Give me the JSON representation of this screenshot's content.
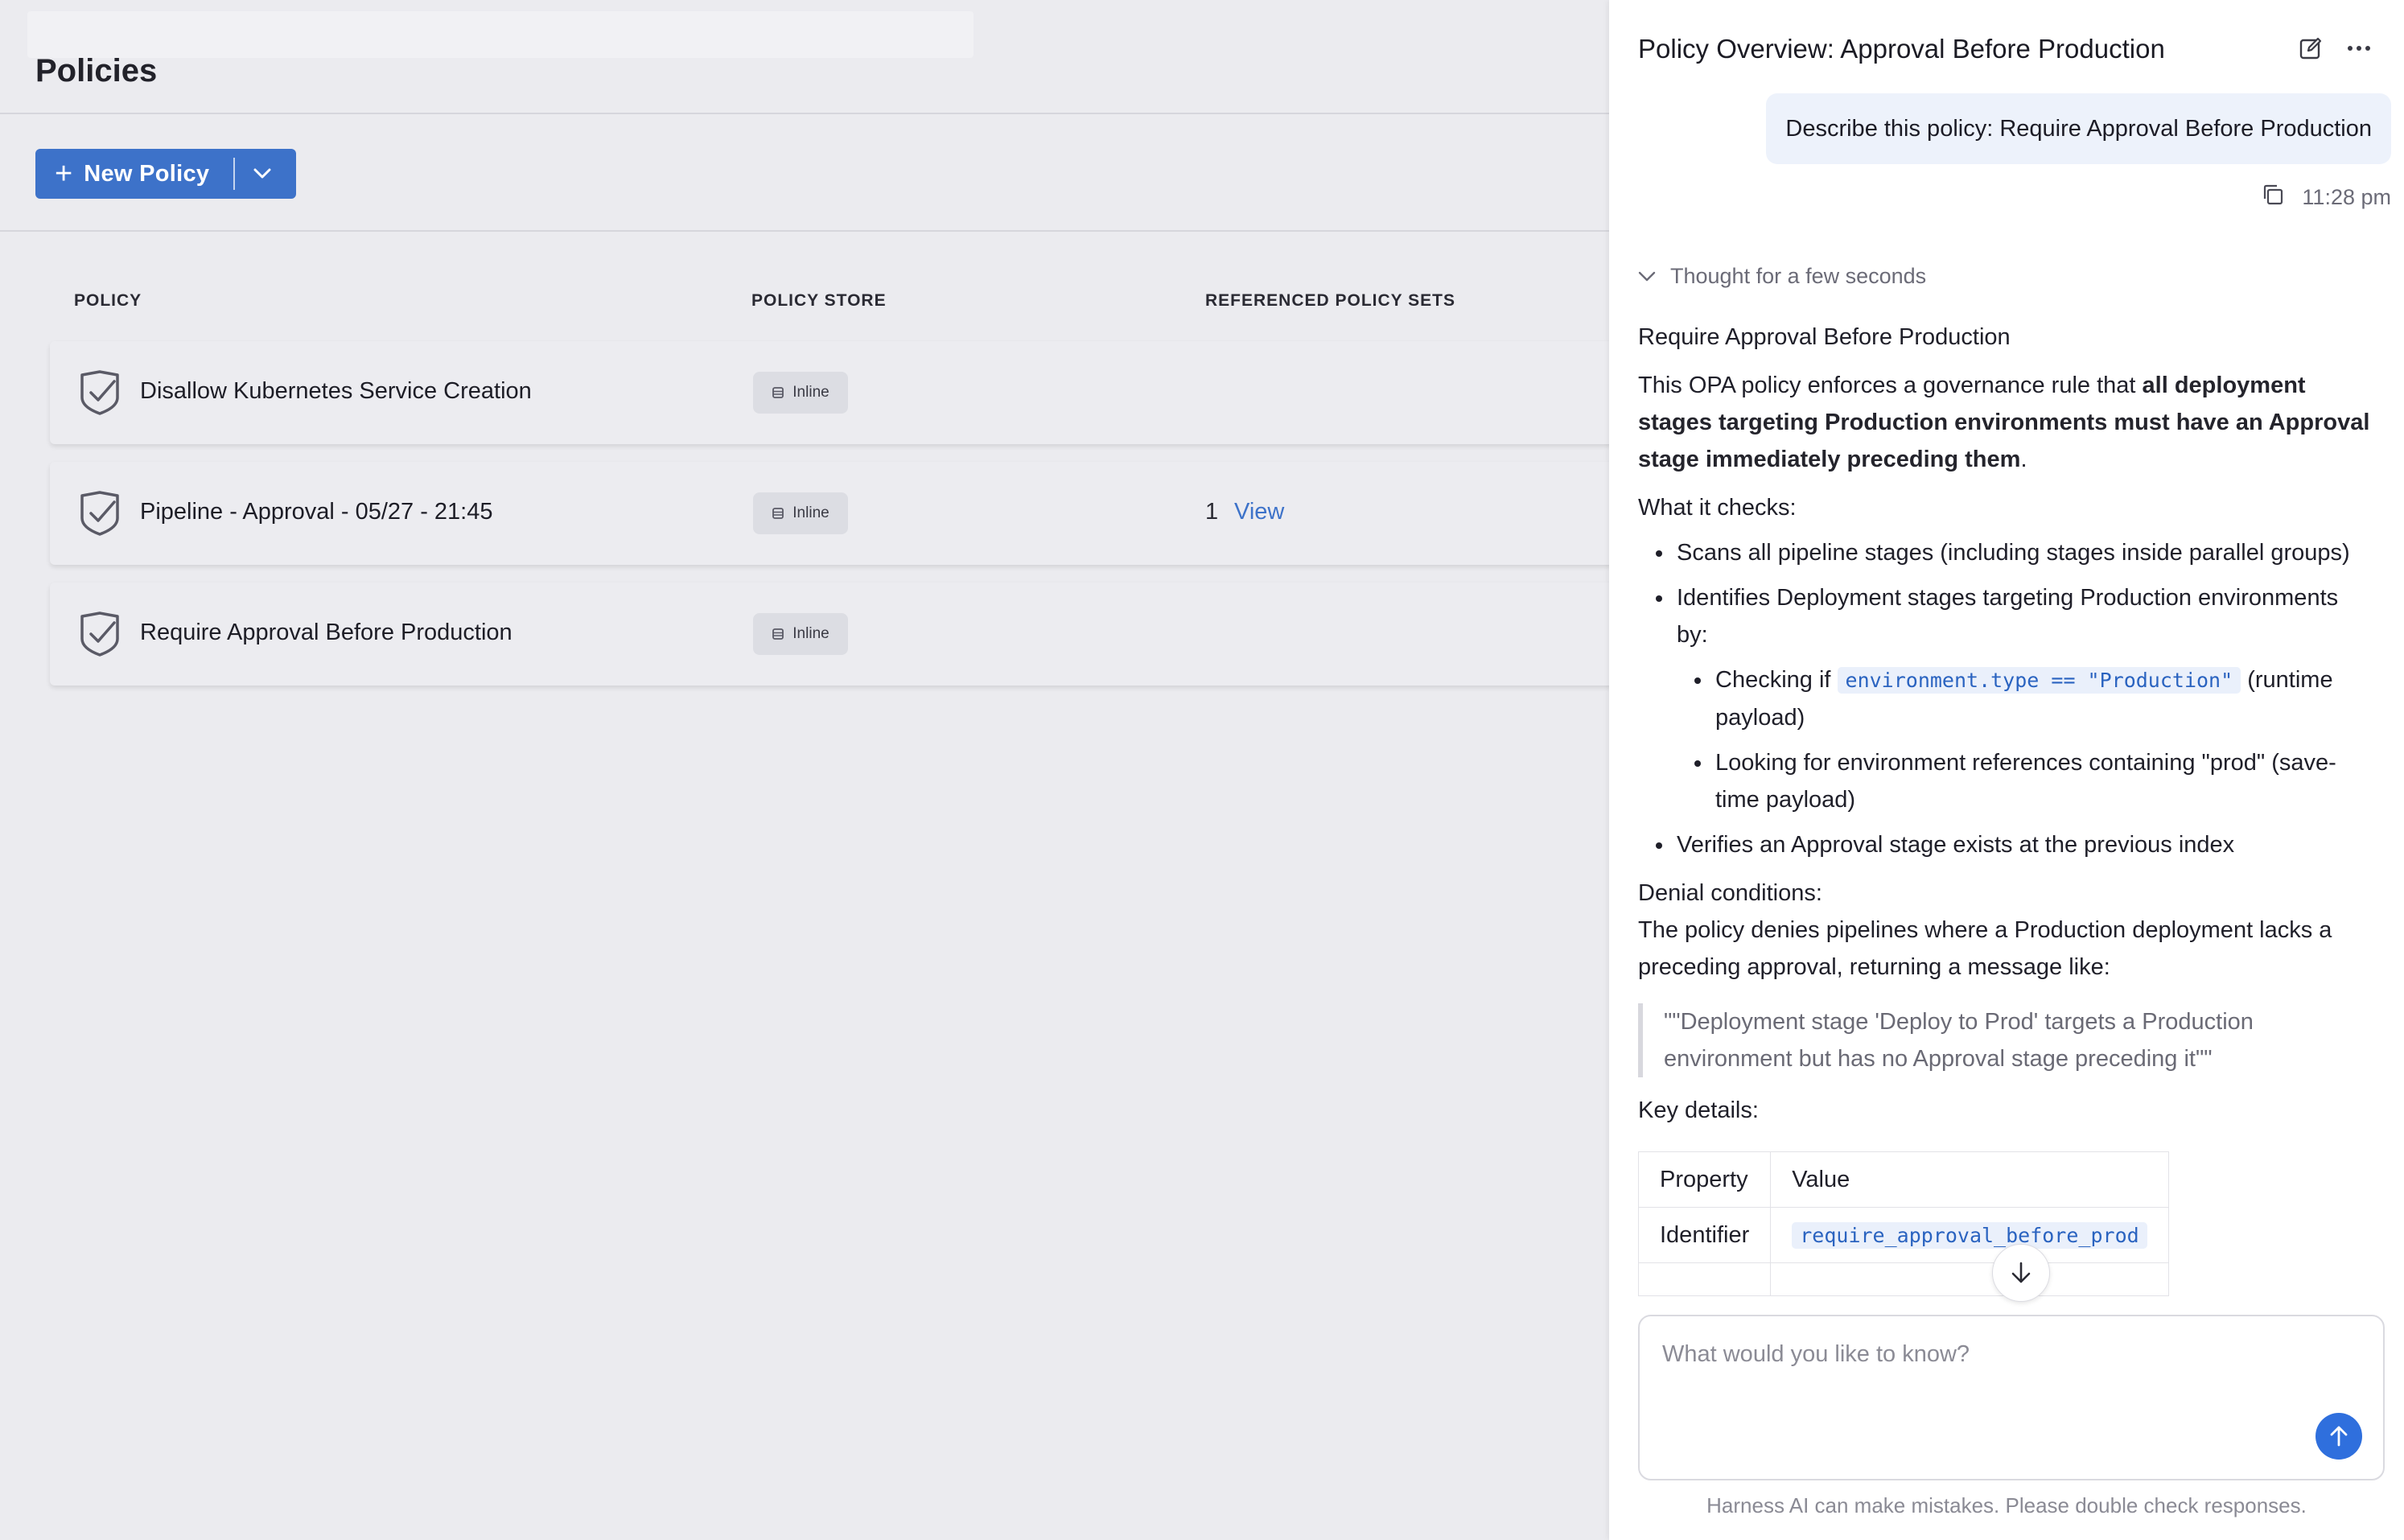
{
  "page": {
    "title": "Policies",
    "new_policy_label": "New Policy"
  },
  "table": {
    "headers": [
      "POLICY",
      "POLICY STORE",
      "REFERENCED POLICY SETS"
    ],
    "rows": [
      {
        "name": "Disallow Kubernetes Service Creation",
        "store": "Inline",
        "ref_count": "",
        "ref_link": ""
      },
      {
        "name": "Pipeline - Approval - 05/27 - 21:45",
        "store": "Inline",
        "ref_count": "1",
        "ref_link": "View"
      },
      {
        "name": "Require Approval Before Production",
        "store": "Inline",
        "ref_count": "",
        "ref_link": ""
      }
    ]
  },
  "panel": {
    "title": "Policy Overview: Approval Before Production",
    "user_message": "Describe this policy: Require Approval Before Production",
    "time": "11:28 pm",
    "thought": "Thought for a few seconds",
    "response": {
      "heading": "Require Approval Before Production",
      "intro_pre": "This OPA policy enforces a governance rule that ",
      "intro_bold": "all deployment stages targeting Production environments must have an Approval stage immediately preceding them",
      "intro_post": ".",
      "checks_title": "What it checks:",
      "check1": "Scans all pipeline stages (including stages inside parallel groups)",
      "check2": "Identifies Deployment stages targeting Production environments by:",
      "sub1_pre": "Checking if ",
      "sub1_code": "environment.type == \"Production\"",
      "sub1_post": " (runtime payload)",
      "sub2": "Looking for environment references containing \"prod\" (save-time payload)",
      "check3": "Verifies an Approval stage exists at the previous index",
      "denial_title": "Denial conditions:",
      "denial_text": "The policy denies pipelines where a Production deployment lacks a preceding approval, returning a message like:",
      "quote": "\"\"Deployment stage 'Deploy to Prod' targets a Production environment but has no Approval stage preceding it\"\"",
      "key_title": "Key details:",
      "table_headers": [
        "Property",
        "Value"
      ],
      "table_row1_property": "Identifier",
      "table_row1_value": "require_approval_before_prod"
    },
    "composer_placeholder": "What would you like to know?",
    "disclaimer": "Harness AI can make mistakes. Please double check responses."
  },
  "colors": {
    "accent": "#3d72c9",
    "send": "#2f6fdd",
    "code_text": "#2a63c0"
  }
}
